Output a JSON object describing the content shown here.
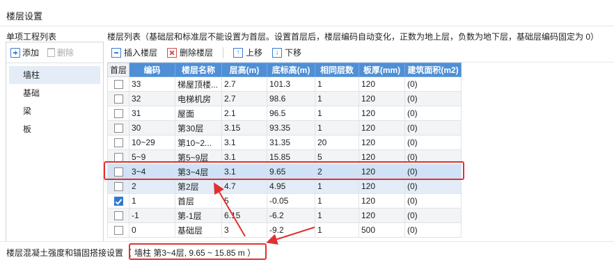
{
  "window": {
    "title": "楼层设置"
  },
  "left": {
    "header": "单项工程列表",
    "add_label": "添加",
    "delete_label": "删除",
    "items": [
      "墙柱",
      "基础",
      "梁",
      "板"
    ],
    "selected_index": 0
  },
  "right": {
    "header": "楼层列表（基础层和标准层不能设置为首层。设置首层后，楼层编码自动变化，正数为地上层，负数为地下层，基础层编码固定为 0）",
    "toolbar": {
      "insert_label": "插入楼层",
      "delete_label": "删除楼层",
      "up_label": "上移",
      "down_label": "下移"
    },
    "columns": [
      "首层",
      "编码",
      "楼层名称",
      "层高(m)",
      "底标高(m)",
      "相同层数",
      "板厚(mm)",
      "建筑面积(m2)"
    ],
    "rows": [
      {
        "first": false,
        "code": "33",
        "name": "梯屋顶楼...",
        "height": "2.7",
        "bottom": "101.3",
        "count": "1",
        "thick": "120",
        "area": "(0)"
      },
      {
        "first": false,
        "code": "32",
        "name": "电梯机房",
        "height": "2.7",
        "bottom": "98.6",
        "count": "1",
        "thick": "120",
        "area": "(0)"
      },
      {
        "first": false,
        "code": "31",
        "name": "屋面",
        "height": "2.1",
        "bottom": "96.5",
        "count": "1",
        "thick": "120",
        "area": "(0)"
      },
      {
        "first": false,
        "code": "30",
        "name": "第30层",
        "height": "3.15",
        "bottom": "93.35",
        "count": "1",
        "thick": "120",
        "area": "(0)"
      },
      {
        "first": false,
        "code": "10~29",
        "name": "第10~2...",
        "height": "3.1",
        "bottom": "31.35",
        "count": "20",
        "thick": "120",
        "area": "(0)"
      },
      {
        "first": false,
        "code": "5~9",
        "name": "第5~9层",
        "height": "3.1",
        "bottom": "15.85",
        "count": "5",
        "thick": "120",
        "area": "(0)"
      },
      {
        "first": false,
        "code": "3~4",
        "name": "第3~4层",
        "height": "3.1",
        "bottom": "9.65",
        "count": "2",
        "thick": "120",
        "area": "(0)"
      },
      {
        "first": false,
        "code": "2",
        "name": "第2层",
        "height": "4.7",
        "bottom": "4.95",
        "count": "1",
        "thick": "120",
        "area": "(0)"
      },
      {
        "first": true,
        "code": "1",
        "name": "首层",
        "height": "5",
        "bottom": "-0.05",
        "count": "1",
        "thick": "120",
        "area": "(0)"
      },
      {
        "first": false,
        "code": "-1",
        "name": "第-1层",
        "height": "6.15",
        "bottom": "-6.2",
        "count": "1",
        "thick": "120",
        "area": "(0)"
      },
      {
        "first": false,
        "code": "0",
        "name": "基础层",
        "height": "3",
        "bottom": "-9.2",
        "count": "1",
        "thick": "500",
        "area": "(0)"
      }
    ],
    "selected_row": 6
  },
  "status": {
    "label": "楼层混凝土强度和锚固搭接设置（",
    "value": "墙柱  第3~4层, 9.65 ~ 15.85 m ）"
  },
  "colors": {
    "header_blue": "#4e8fd6",
    "highlight_red": "#e23030",
    "selected_row": "#cfe2f7"
  }
}
